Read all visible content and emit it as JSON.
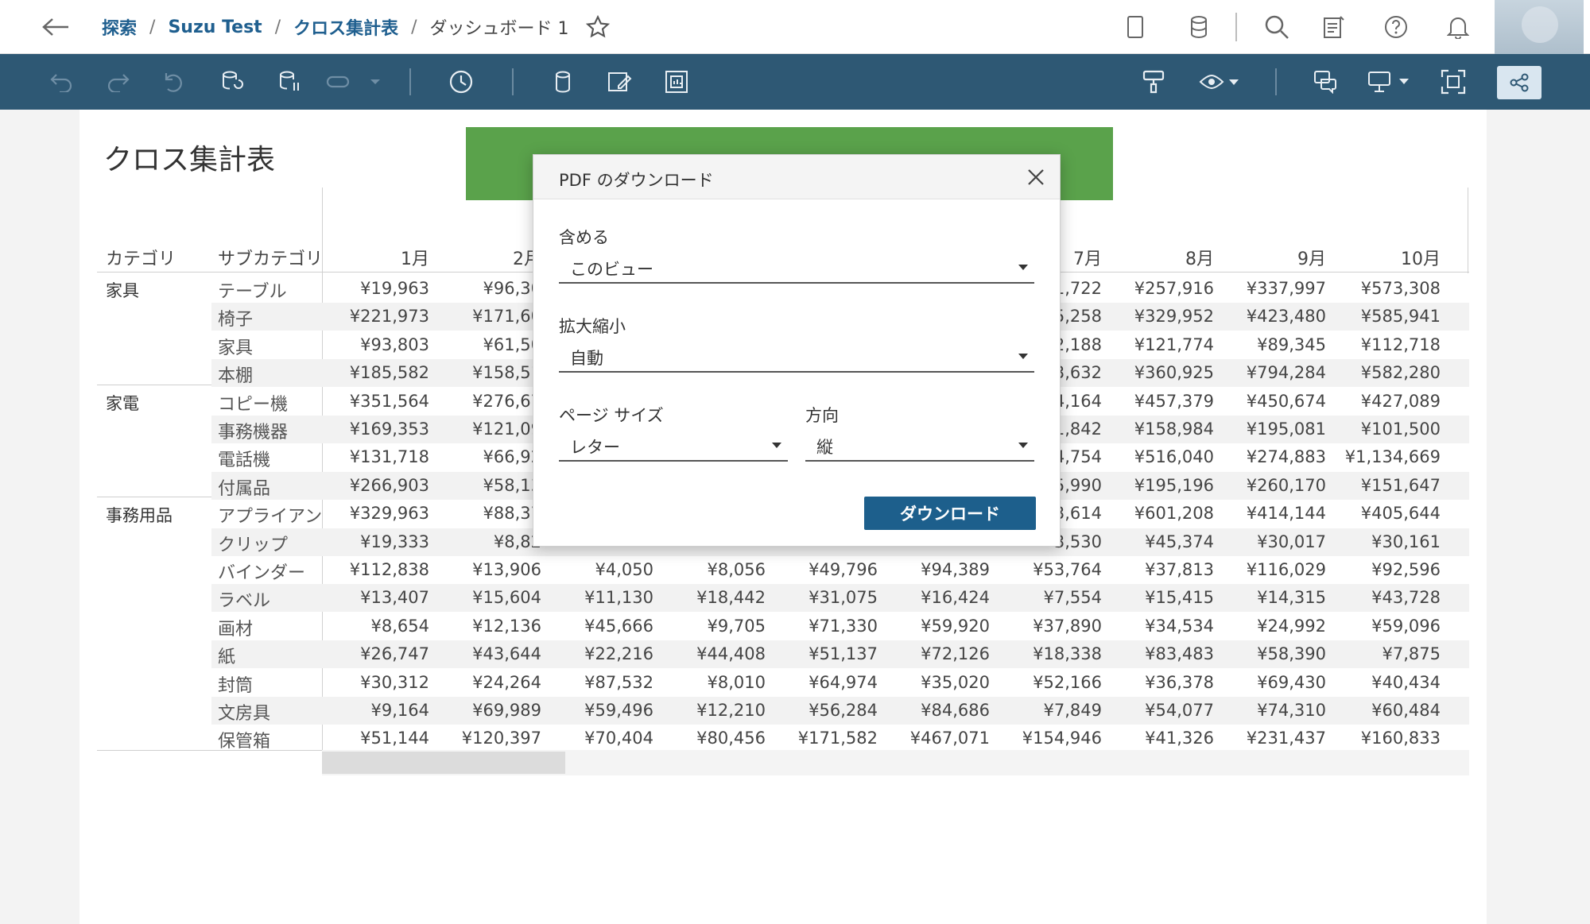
{
  "breadcrumb": {
    "items": [
      "探索",
      "Suzu Test",
      "クロス集計表"
    ],
    "current": "ダッシュボード 1",
    "separator": "/"
  },
  "topbar_icons": [
    "back-arrow-icon",
    "star-icon",
    "device-preview-icon",
    "data-source-icon",
    "search-icon",
    "notes-icon",
    "help-icon",
    "bell-icon"
  ],
  "toolbar_icons": [
    "undo-icon",
    "redo-icon",
    "revert-icon",
    "refresh-data-icon",
    "pause-updates-icon",
    "swap-icon",
    "dropdown-icon",
    "clock-icon",
    "data-icon",
    "edit-datasource-icon",
    "view-data-icon",
    "format-painter-icon",
    "view-icon",
    "comment-icon",
    "present-icon",
    "fit-icon",
    "share-icon"
  ],
  "dashboard": {
    "title": "クロス集計表"
  },
  "table": {
    "header_category": "カテゴリ",
    "header_subcategory": "サブカテゴリ",
    "month_headers": [
      "1月",
      "2月",
      "7月",
      "8月",
      "9月",
      "10月"
    ],
    "categories": [
      {
        "name": "家具",
        "rows": [
          {
            "sub": "テーブル",
            "left": [
              "¥19,963",
              "¥96,30"
            ],
            "right": [
              "1,722",
              "¥257,916",
              "¥337,997",
              "¥573,308"
            ]
          },
          {
            "sub": "椅子",
            "left": [
              "¥221,973",
              "¥171,60"
            ],
            "right": [
              "5,258",
              "¥329,952",
              "¥423,480",
              "¥585,941"
            ]
          },
          {
            "sub": "家具",
            "left": [
              "¥93,803",
              "¥61,50"
            ],
            "right": [
              "2,188",
              "¥121,774",
              "¥89,345",
              "¥112,718"
            ]
          },
          {
            "sub": "本棚",
            "left": [
              "¥185,582",
              "¥158,51"
            ],
            "right": [
              "3,632",
              "¥360,925",
              "¥794,284",
              "¥582,280"
            ]
          }
        ]
      },
      {
        "name": "家電",
        "rows": [
          {
            "sub": "コピー機",
            "left": [
              "¥351,564",
              "¥276,67"
            ],
            "right": [
              "4,164",
              "¥457,379",
              "¥450,674",
              "¥427,089"
            ]
          },
          {
            "sub": "事務機器",
            "left": [
              "¥169,353",
              "¥121,09"
            ],
            "right": [
              "1,842",
              "¥158,984",
              "¥195,081",
              "¥101,500"
            ]
          },
          {
            "sub": "電話機",
            "left": [
              "¥131,718",
              "¥66,92"
            ],
            "right": [
              "4,754",
              "¥516,040",
              "¥274,883",
              "¥1,134,669"
            ]
          },
          {
            "sub": "付属品",
            "left": [
              "¥266,903",
              "¥58,13"
            ],
            "right": [
              "5,990",
              "¥195,196",
              "¥260,170",
              "¥151,647"
            ]
          }
        ]
      },
      {
        "name": "事務用品",
        "rows": [
          {
            "sub": "アプライアン",
            "left": [
              "¥329,963",
              "¥88,37"
            ],
            "right": [
              "3,614",
              "¥601,208",
              "¥414,144",
              "¥405,644"
            ]
          },
          {
            "sub": "クリップ",
            "left": [
              "¥19,333",
              "¥8,82"
            ],
            "right": [
              "3,530",
              "¥45,374",
              "¥30,017",
              "¥30,161"
            ]
          }
        ]
      }
    ],
    "full_rows": [
      {
        "sub": "バインダー",
        "values": [
          "¥112,838",
          "¥13,906",
          "¥4,050",
          "¥8,056",
          "¥49,796",
          "¥94,389",
          "¥53,764",
          "¥37,813",
          "¥116,029",
          "¥92,596"
        ]
      },
      {
        "sub": "ラベル",
        "values": [
          "¥13,407",
          "¥15,604",
          "¥11,130",
          "¥18,442",
          "¥31,075",
          "¥16,424",
          "¥7,554",
          "¥15,415",
          "¥14,315",
          "¥43,728"
        ]
      },
      {
        "sub": "画材",
        "values": [
          "¥8,654",
          "¥12,136",
          "¥45,666",
          "¥9,705",
          "¥71,330",
          "¥59,920",
          "¥37,890",
          "¥34,534",
          "¥24,992",
          "¥59,096"
        ]
      },
      {
        "sub": "紙",
        "values": [
          "¥26,747",
          "¥43,644",
          "¥22,216",
          "¥44,408",
          "¥51,137",
          "¥72,126",
          "¥18,338",
          "¥83,483",
          "¥58,390",
          "¥7,875"
        ]
      },
      {
        "sub": "封筒",
        "values": [
          "¥30,312",
          "¥24,264",
          "¥87,532",
          "¥8,010",
          "¥64,974",
          "¥35,020",
          "¥52,166",
          "¥36,378",
          "¥69,430",
          "¥40,434"
        ]
      },
      {
        "sub": "文房具",
        "values": [
          "¥9,164",
          "¥69,989",
          "¥59,496",
          "¥12,210",
          "¥56,284",
          "¥84,686",
          "¥7,849",
          "¥54,077",
          "¥74,310",
          "¥60,484"
        ]
      },
      {
        "sub": "保管箱",
        "values": [
          "¥51,144",
          "¥120,397",
          "¥70,404",
          "¥80,456",
          "¥171,582",
          "¥467,071",
          "¥154,946",
          "¥41,326",
          "¥231,437",
          "¥160,833"
        ]
      }
    ]
  },
  "dialog": {
    "title": "PDF のダウンロード",
    "include_label": "含める",
    "include_value": "このビュー",
    "scale_label": "拡大縮小",
    "scale_value": "自動",
    "page_size_label": "ページ サイズ",
    "page_size_value": "レター",
    "orientation_label": "方向",
    "orientation_value": "縦",
    "download_button": "ダウンロード"
  },
  "colors": {
    "toolbar_bg": "#2e5874",
    "accent_link": "#1f5f8f",
    "green_banner": "#5aa24b",
    "download_button": "#1d5f8c"
  }
}
